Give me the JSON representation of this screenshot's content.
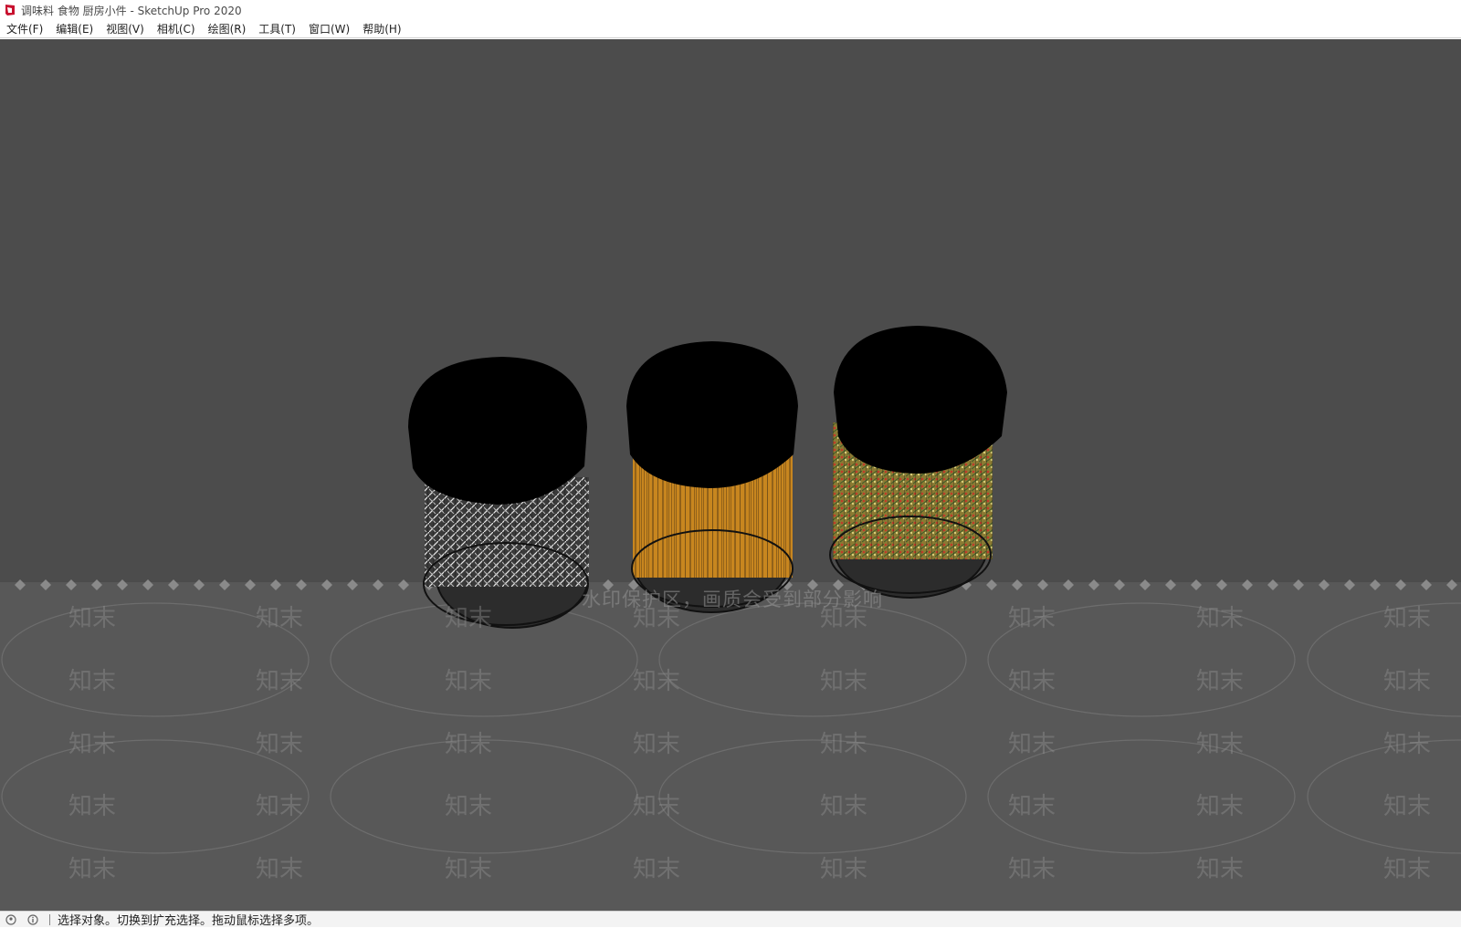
{
  "window": {
    "title": "调味料 食物 厨房小件 - SketchUp Pro 2020",
    "icon": "sketchup-logo-icon",
    "accent_color": "#c8102e"
  },
  "menu": [
    {
      "label": "文件(F)"
    },
    {
      "label": "编辑(E)"
    },
    {
      "label": "视图(V)"
    },
    {
      "label": "相机(C)"
    },
    {
      "label": "绘图(R)"
    },
    {
      "label": "工具(T)"
    },
    {
      "label": "窗口(W)"
    },
    {
      "label": "帮助(H)"
    }
  ],
  "viewport": {
    "background": "#4c4c4c",
    "watermark_notice": "水印保护区，画质会受到部分影响",
    "watermark_tile_text": "知末",
    "models": [
      {
        "name": "jar-left",
        "content": "white sticks",
        "color": "#cfcfcf"
      },
      {
        "name": "jar-middle",
        "content": "orange spice",
        "color": "#c8861f"
      },
      {
        "name": "jar-right",
        "content": "mixed herbs",
        "color": "#9c8a3c"
      }
    ]
  },
  "status": {
    "text": "选择对象。切换到扩充选择。拖动鼠标选择多项。",
    "icons": [
      "geo-location-icon",
      "info-icon"
    ]
  }
}
